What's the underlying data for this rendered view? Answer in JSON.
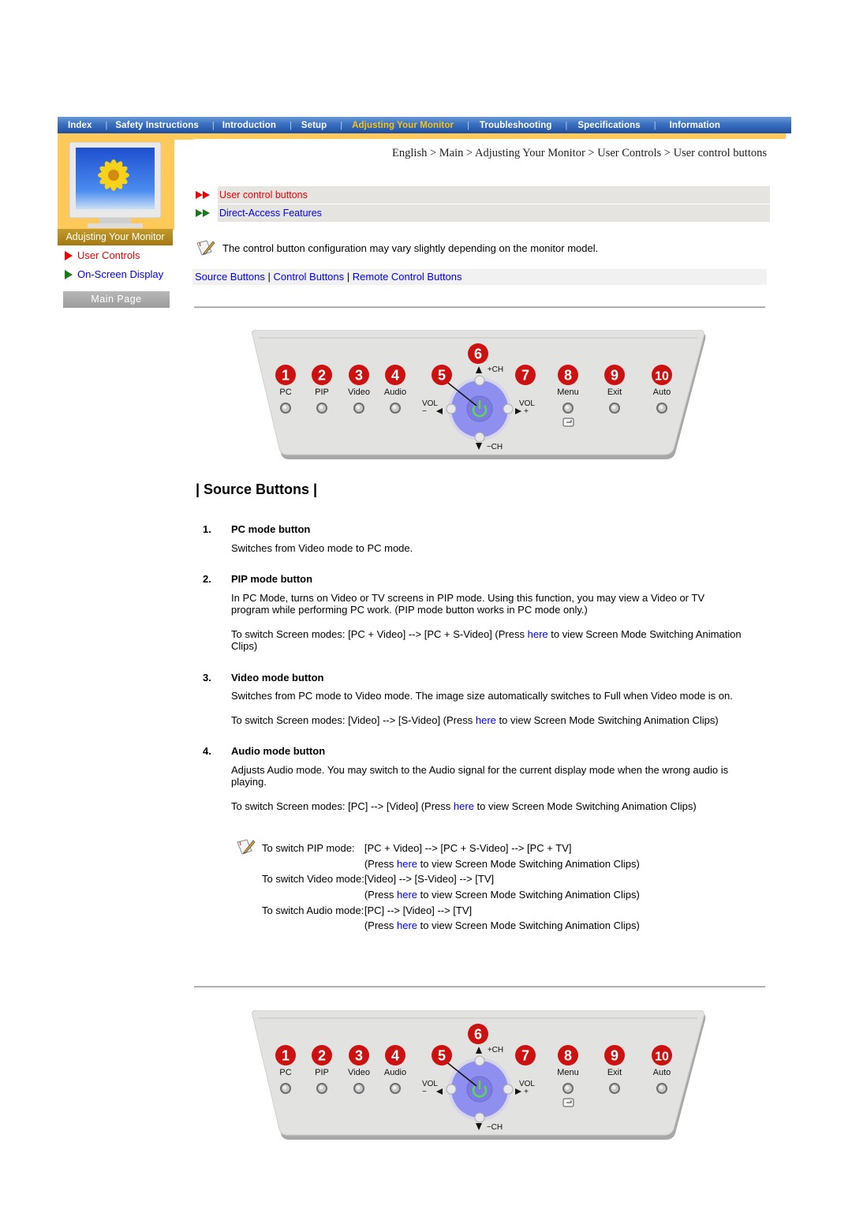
{
  "nav": {
    "items": [
      {
        "label": "Index",
        "active": false
      },
      {
        "label": "Safety Instructions",
        "active": false
      },
      {
        "label": "Introduction",
        "active": false
      },
      {
        "label": "Setup",
        "active": false
      },
      {
        "label": "Adjusting Your Monitor",
        "active": true
      },
      {
        "label": "Troubleshooting",
        "active": false
      },
      {
        "label": "Specifications",
        "active": false
      },
      {
        "label": "Information",
        "active": false
      }
    ],
    "separator": "|"
  },
  "sidebar": {
    "title": "Adujsting Your Monitor",
    "links": [
      {
        "label": "User Controls",
        "current": true
      },
      {
        "label": "On-Screen Display",
        "current": false
      }
    ],
    "main_page_button": "Main Page"
  },
  "breadcrumb": "English > Main > Adjusting Your Monitor > User Controls > User control buttons",
  "sections": [
    {
      "label": "User control buttons",
      "current": true
    },
    {
      "label": "Direct-Access Features",
      "current": false
    }
  ],
  "note": "The control button configuration may vary slightly depending on the monitor model.",
  "subnav": {
    "links": [
      "Source Buttons",
      "Control Buttons",
      "Remote Control Buttons"
    ],
    "separator": "|"
  },
  "panel": {
    "buttons": [
      {
        "num": "1",
        "label": "PC"
      },
      {
        "num": "2",
        "label": "PIP"
      },
      {
        "num": "3",
        "label": "Video"
      },
      {
        "num": "4",
        "label": "Audio"
      },
      {
        "num": "5",
        "label": "Power"
      },
      {
        "num": "6",
        "label": "+CH"
      },
      {
        "num": "7",
        "label": "VOL +"
      },
      {
        "num": "8",
        "label": "Menu"
      },
      {
        "num": "9",
        "label": "Exit"
      },
      {
        "num": "10",
        "label": "Auto"
      }
    ],
    "vol_label": "VOL",
    "vol_minus": "−",
    "vol_plus": "+",
    "ch_plus": "+CH",
    "ch_minus": "−CH"
  },
  "section_title": "| Source Buttons |",
  "items": [
    {
      "num": "1.",
      "title": "PC mode button",
      "paras": [
        {
          "text": "Switches from Video mode to PC mode."
        }
      ]
    },
    {
      "num": "2.",
      "title": "PIP mode button",
      "paras": [
        {
          "text": "In PC Mode, turns on Video or TV screens in PIP mode. Using this function, you may view a Video or TV program while performing PC work. (PIP mode button works in PC mode only.)"
        },
        {
          "pre": "To switch Screen modes: [PC + Video] --> [PC + S-Video] (Press ",
          "link": "here",
          "post": " to view Screen Mode Switching Animation Clips)"
        }
      ]
    },
    {
      "num": "3.",
      "title": "Video mode button",
      "paras": [
        {
          "text": "Switches from PC mode to Video mode. The image size automatically switches to Full when Video mode is on."
        },
        {
          "pre": "To switch Screen modes: [Video] --> [S-Video] (Press ",
          "link": "here",
          "post": " to view Screen Mode Switching Animation Clips)"
        }
      ]
    },
    {
      "num": "4.",
      "title": "Audio mode button",
      "paras": [
        {
          "text": "Adjusts Audio mode. You may switch to the Audio signal for the current display mode when the wrong audio is playing."
        },
        {
          "pre": "To switch Screen modes: [PC] --> [Video] (Press ",
          "link": "here",
          "post": " to view Screen Mode Switching Animation Clips)"
        }
      ]
    }
  ],
  "mode_notes": [
    {
      "label": "To switch PIP mode:",
      "sequence": "[PC + Video] --> [PC + S-Video] --> [PC + TV]",
      "press_pre": "(Press ",
      "link": "here",
      "press_post": " to view Screen Mode Switching Animation Clips)"
    },
    {
      "label": "To switch Video mode:",
      "sequence": "[Video] --> [S-Video] --> [TV]",
      "press_pre": "(Press ",
      "link": "here",
      "press_post": " to view Screen Mode Switching Animation Clips)"
    },
    {
      "label": "To switch Audio mode:",
      "sequence": "[PC] --> [Video] --> [TV]",
      "press_pre": "(Press ",
      "link": "here",
      "press_post": " to view Screen Mode Switching Animation Clips)"
    }
  ],
  "colors": {
    "nav_blue": "#2f5faf",
    "nav_active": "#f5c21b",
    "orange": "#ffc95a",
    "current_link": "#ee0000",
    "link": "#0000ee",
    "badge_red": "#cc1111",
    "dpad_blue": "#8f8ff0"
  }
}
